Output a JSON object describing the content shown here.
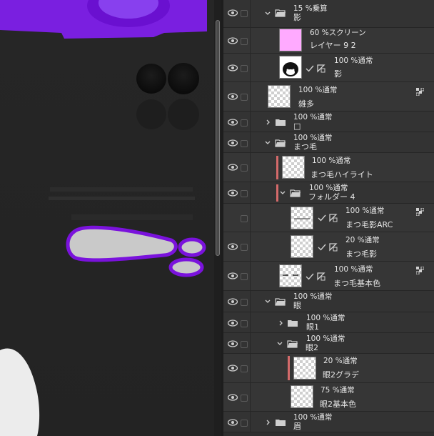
{
  "colors": {
    "panel_bg": "#2e2e2e",
    "row_bg": "#363636",
    "accent_clip": "#d46a6a",
    "fill_pink": "#ffaaff",
    "canvas_purple": "#7a1fe0"
  },
  "layers": [
    {
      "type": "folder",
      "expanded": true,
      "mode": "15 %乗算",
      "name": "影"
    },
    {
      "type": "layer",
      "mode": "60 %スクリーン",
      "name": "レイヤー 9 2",
      "thumb": "pink"
    },
    {
      "type": "layer",
      "mode": "100 %通常",
      "name": "影",
      "thumb": "char"
    },
    {
      "type": "layer",
      "mode": "100 %通常",
      "name": "雑多",
      "thumb": "blank"
    },
    {
      "type": "folder",
      "expanded": false,
      "mode": "100 %通常",
      "name": "□"
    },
    {
      "type": "folder",
      "expanded": true,
      "mode": "100 %通常",
      "name": "まつ毛"
    },
    {
      "type": "layer",
      "mode": "100 %通常",
      "name": "まつ毛ハイライト",
      "thumb": "blank"
    },
    {
      "type": "folder",
      "expanded": true,
      "mode": "100 %通常",
      "name": "フォルダー 4"
    },
    {
      "type": "layer",
      "mode": "100 %通常",
      "name": "まつ毛影ARC",
      "thumb": "blank"
    },
    {
      "type": "layer",
      "mode": "20 %通常",
      "name": "まつ毛影",
      "thumb": "blank"
    },
    {
      "type": "layer",
      "mode": "100 %通常",
      "name": "まつ毛基本色",
      "thumb": "blank"
    },
    {
      "type": "folder",
      "expanded": true,
      "mode": "100 %通常",
      "name": "眼"
    },
    {
      "type": "folder",
      "expanded": false,
      "mode": "100 %通常",
      "name": "眼1"
    },
    {
      "type": "folder",
      "expanded": true,
      "mode": "100 %通常",
      "name": "眼2"
    },
    {
      "type": "layer",
      "mode": "20 %通常",
      "name": "眼2グラデ",
      "thumb": "blank"
    },
    {
      "type": "layer",
      "mode": "75 %通常",
      "name": "眼2基本色",
      "thumb": "blank"
    },
    {
      "type": "folder",
      "expanded": false,
      "mode": "100 %通常",
      "name": "眉"
    }
  ]
}
